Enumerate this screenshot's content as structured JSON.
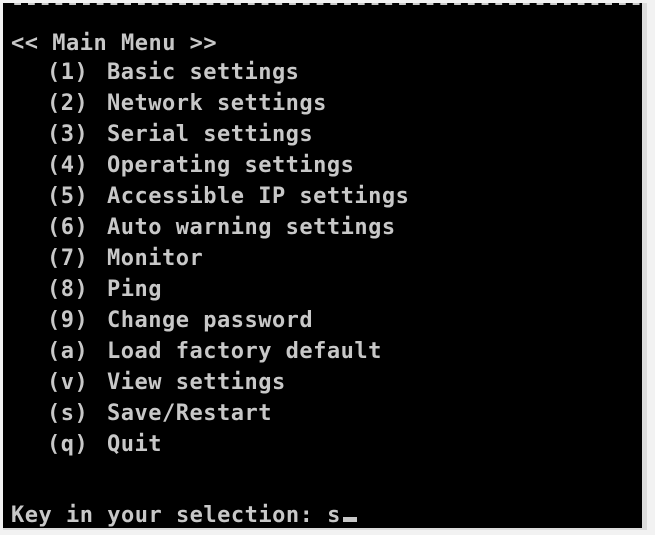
{
  "terminal": {
    "separator": "---------------------------------------------------",
    "header": "<< Main Menu >>",
    "menu": [
      {
        "key": "(1)",
        "label": "Basic settings"
      },
      {
        "key": "(2)",
        "label": "Network settings"
      },
      {
        "key": "(3)",
        "label": "Serial settings"
      },
      {
        "key": "(4)",
        "label": "Operating settings"
      },
      {
        "key": "(5)",
        "label": "Accessible IP settings"
      },
      {
        "key": "(6)",
        "label": "Auto warning settings"
      },
      {
        "key": "(7)",
        "label": "Monitor"
      },
      {
        "key": "(8)",
        "label": "Ping"
      },
      {
        "key": "(9)",
        "label": "Change password"
      },
      {
        "key": "(a)",
        "label": "Load factory default"
      },
      {
        "key": "(v)",
        "label": "View settings"
      },
      {
        "key": "(s)",
        "label": "Save/Restart"
      },
      {
        "key": "(q)",
        "label": "Quit"
      }
    ],
    "prompt": "Key in your selection: ",
    "input_value": "s"
  },
  "colors": {
    "background": "#000000",
    "text": "#c8c8c8"
  }
}
